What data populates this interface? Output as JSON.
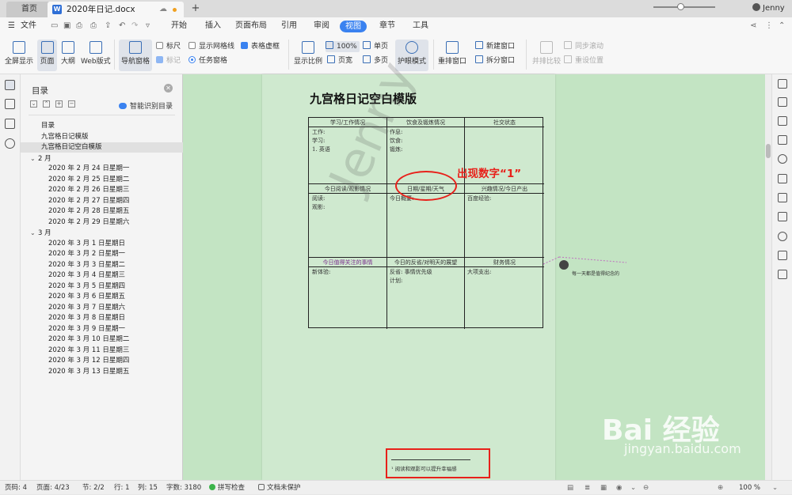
{
  "tabs": {
    "home": "首页",
    "doc": "2020年日记.docx",
    "add": "+"
  },
  "user": {
    "name": "Jenny"
  },
  "menu": {
    "file": "文件",
    "items": [
      "开始",
      "插入",
      "页面布局",
      "引用",
      "审阅",
      "视图",
      "章节",
      "工具"
    ],
    "active": "视图"
  },
  "ribbon": {
    "fullscreen": "全屏显示",
    "page": "页面",
    "outline": "大纲",
    "web": "Web版式",
    "navpane": "导航窗格",
    "ruler": "标尺",
    "gridlines": "显示网格线",
    "tablegrid": "表格虚框",
    "mark": "标记",
    "taskpane": "任务窗格",
    "zoomratio": "显示比例",
    "zoom100": "100%",
    "singlepage": "单页",
    "pagewidth": "页宽",
    "multipage": "多页",
    "eyeprotect": "护眼模式",
    "rearrange": "重排窗口",
    "newwindow": "新建窗口",
    "splitwindow": "拆分窗口",
    "sidebyside": "并排比较",
    "syncscroll": "同步滚动",
    "resetpos": "重设位置"
  },
  "nav": {
    "title": "目录",
    "smart": "智能识别目录",
    "items": [
      {
        "label": "目录",
        "level": 1
      },
      {
        "label": "九宫格日记模版",
        "level": 1
      },
      {
        "label": "九宫格日记空白模版",
        "level": 1,
        "selected": true
      },
      {
        "label": "2 月",
        "level": 0,
        "expand": true
      },
      {
        "label": "2020 年 2 月 24 日星期一",
        "level": 2
      },
      {
        "label": "2020 年 2 月 25 日星期二",
        "level": 2
      },
      {
        "label": "2020 年 2 月 26 日星期三",
        "level": 2
      },
      {
        "label": "2020 年 2 月 27 日星期四",
        "level": 2
      },
      {
        "label": "2020 年 2 月 28 日星期五",
        "level": 2
      },
      {
        "label": "2020 年 2 月 29 日星期六",
        "level": 2
      },
      {
        "label": "3 月",
        "level": 0,
        "expand": true
      },
      {
        "label": "2020 年 3 月 1 日星期日",
        "level": 2
      },
      {
        "label": "2020 年 3 月 2 日星期一",
        "level": 2
      },
      {
        "label": "2020 年 3 月 3 日星期二",
        "level": 2
      },
      {
        "label": "2020 年 3 月 4 日星期三",
        "level": 2
      },
      {
        "label": "2020 年 3 月 5 日星期四",
        "level": 2
      },
      {
        "label": "2020 年 3 月 6 日星期五",
        "level": 2
      },
      {
        "label": "2020 年 3 月 7 日星期六",
        "level": 2
      },
      {
        "label": "2020 年 3 月 8 日星期日",
        "level": 2
      },
      {
        "label": "2020 年 3 月 9 日星期一",
        "level": 2
      },
      {
        "label": "2020 年 3 月 10 日星期二",
        "level": 2
      },
      {
        "label": "2020 年 3 月 11 日星期三",
        "level": 2
      },
      {
        "label": "2020 年 3 月 12 日星期四",
        "level": 2
      },
      {
        "label": "2020 年 3 月 13 日星期五",
        "level": 2
      }
    ]
  },
  "document": {
    "title": "九宫格日记空白模版",
    "watermark": "Jenny",
    "grid": {
      "r1h": [
        "学习/工作情况",
        "饮食及锻炼情况",
        "社交状态"
      ],
      "r1b": [
        "工作:\n学习:\n1. 英语",
        "作息:\n饮食:\n锻炼:",
        ""
      ],
      "r2h": [
        "今日阅读/观影情况",
        "日期/星期/天气",
        "兴趣情况/今日产出"
      ],
      "r2b": [
        "阅读:\n观影:",
        "今日概要:",
        "百度经验:"
      ],
      "r3h": [
        "今日值得关注的事情",
        "今日的反省/对明天的展望",
        "财务情况"
      ],
      "r3b": [
        "新体验:",
        "反省: 事情优先级\n计划:",
        "大项支出:"
      ]
    },
    "annotation": "出现数字“1”",
    "footnote": "¹ 阅读和观影可以提升幸福感",
    "comment": "每一天都是值得纪念的"
  },
  "status": {
    "pages": "页码: 4",
    "pagecount": "页面: 4/23",
    "section": "节: 2/2",
    "row": "行: 1",
    "col": "列: 15",
    "words": "字数: 3180",
    "spell": "拼写检查",
    "protect": "文档未保护",
    "zoom": "100 %"
  },
  "watermark": {
    "brand": "Bai 经验",
    "url": "jingyan.baidu.com"
  }
}
